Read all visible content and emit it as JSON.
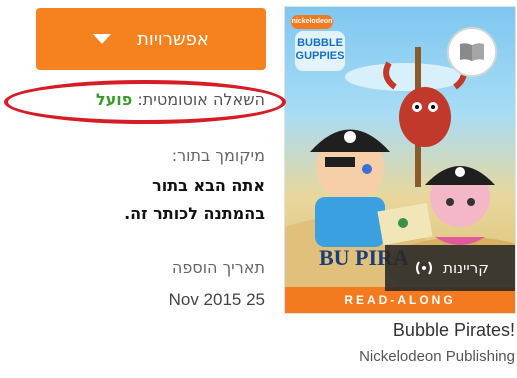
{
  "book": {
    "title": "Bubble Pirates!",
    "publisher": "Nickelodeon Publishing",
    "cover": {
      "brand_badge": "nickelodeon",
      "series_logo_line1": "BUBBLE",
      "series_logo_line2": "GUPPIES",
      "title_partial": "BU PIRA",
      "read_along_label": "READ-ALONG",
      "book_icon": "open-book-icon"
    }
  },
  "read_button": {
    "label": "קריינות",
    "icon": "audio-waves-icon"
  },
  "options": {
    "label": "אפשרויות",
    "icon": "caret-down-icon"
  },
  "auto_loan": {
    "label": "השאלה אוטומטית:",
    "status": "פועל",
    "status_color": "#3c9a2d"
  },
  "queue": {
    "label": "מיקומך בתור:",
    "line1": "אתה הבא בתור",
    "line2": "בהמתנה לכותר זה."
  },
  "added": {
    "label": "תאריך הוספה",
    "date": "Nov 2015 25"
  },
  "colors": {
    "accent": "#f5821f",
    "highlight": "#d61d24"
  }
}
